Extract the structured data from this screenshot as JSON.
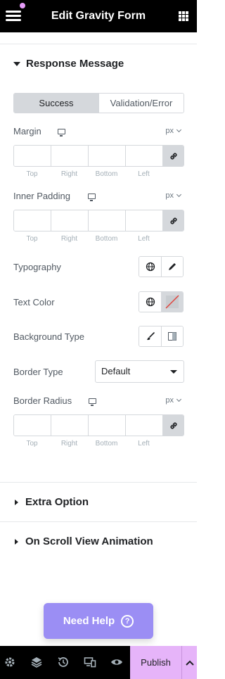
{
  "header": {
    "title": "Edit Gravity Form"
  },
  "sections": {
    "response_message": "Response Message",
    "extra_option": "Extra Option",
    "on_scroll": "On Scroll View Animation"
  },
  "tabs": [
    {
      "label": "Success",
      "active": true
    },
    {
      "label": "Validation/Error",
      "active": false
    }
  ],
  "margin": {
    "label": "Margin",
    "unit": "px"
  },
  "inner_padding": {
    "label": "Inner Padding",
    "unit": "px"
  },
  "border_radius": {
    "label": "Border Radius",
    "unit": "px"
  },
  "dimension_labels": [
    "Top",
    "Right",
    "Bottom",
    "Left"
  ],
  "typography": {
    "label": "Typography"
  },
  "text_color": {
    "label": "Text Color"
  },
  "background_type": {
    "label": "Background Type"
  },
  "border_type": {
    "label": "Border Type",
    "value": "Default"
  },
  "help": {
    "label": "Need Help",
    "icon": "?"
  },
  "footer": {
    "publish_label": "Publish"
  },
  "colors": {
    "accent": "#9b8ef4",
    "publish_bg": "#e6b4f9",
    "header_bg": "#000000"
  }
}
